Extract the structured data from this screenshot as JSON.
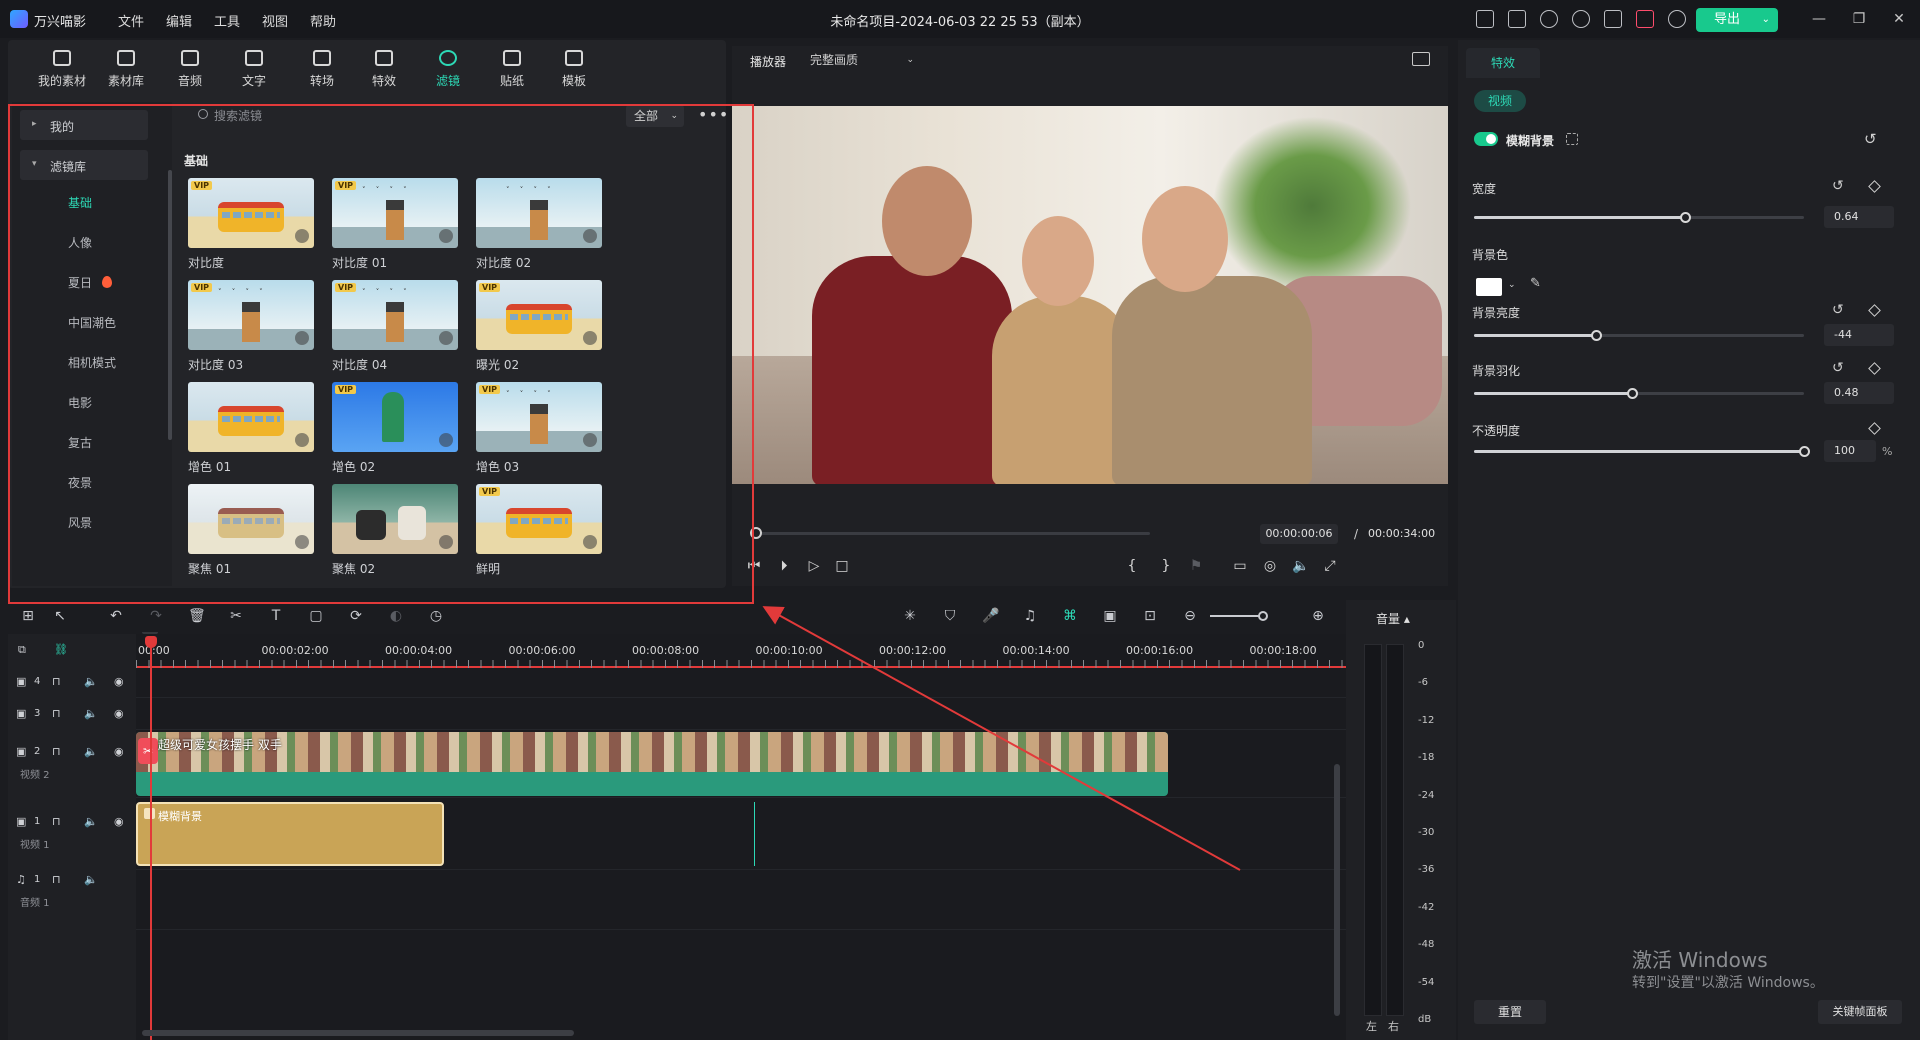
{
  "app": {
    "name": "万兴喵影",
    "project_title": "未命名项目-2024-06-03 22 25 53（副本）",
    "menu": [
      "文件",
      "编辑",
      "工具",
      "视图",
      "帮助"
    ],
    "export_label": "导出",
    "accent_color": "#18c98d"
  },
  "media_tabs": [
    {
      "label": "我的素材",
      "icon": "my-media-icon"
    },
    {
      "label": "素材库",
      "icon": "stock-library-icon"
    },
    {
      "label": "音频",
      "icon": "music-note-icon"
    },
    {
      "label": "文字",
      "icon": "text-icon"
    },
    {
      "label": "转场",
      "icon": "transition-icon"
    },
    {
      "label": "特效",
      "icon": "effects-icon"
    },
    {
      "label": "滤镜",
      "icon": "filters-icon",
      "active": true
    },
    {
      "label": "贴纸",
      "icon": "sticker-icon"
    },
    {
      "label": "模板",
      "icon": "template-icon"
    }
  ],
  "filter_sidebar": {
    "mine": "我的",
    "library": "滤镜库",
    "categories": [
      "基础",
      "人像",
      "夏日",
      "中国潮色",
      "相机模式",
      "电影",
      "复古",
      "夜景",
      "风景"
    ],
    "active": "基础"
  },
  "filter_search": {
    "placeholder": "搜索滤镜",
    "filter_value": "全部",
    "more_icon": "more-dots-icon"
  },
  "filter_section": "基础",
  "filters": [
    {
      "label": "对比度",
      "vip": true,
      "scene": "bus"
    },
    {
      "label": "对比度 01",
      "vip": true,
      "scene": "tower"
    },
    {
      "label": "对比度 02",
      "vip": false,
      "scene": "tower"
    },
    {
      "label": "对比度 03",
      "vip": true,
      "scene": "tower"
    },
    {
      "label": "对比度 04",
      "vip": true,
      "scene": "tower"
    },
    {
      "label": "曝光 02",
      "vip": true,
      "scene": "bus"
    },
    {
      "label": "增色 01",
      "vip": false,
      "scene": "bus"
    },
    {
      "label": "增色 02",
      "vip": true,
      "scene": "blue"
    },
    {
      "label": "增色 03",
      "vip": true,
      "scene": "tower"
    },
    {
      "label": "聚焦 01",
      "vip": false,
      "scene": "bus-gray"
    },
    {
      "label": "聚焦 02",
      "vip": false,
      "scene": "green"
    },
    {
      "label": "鲜明",
      "vip": true,
      "scene": "bus"
    }
  ],
  "vip_badge": "VIP",
  "player": {
    "label": "播放器",
    "quality": "完整画质",
    "time_current": "00:00:00:06",
    "time_separator": "/",
    "time_total": "00:00:34:00",
    "progress": 0.005
  },
  "effects_panel": {
    "tab": "特效",
    "subtab": "视频",
    "blur_title": "模糊背景",
    "blur_enabled": true,
    "props": [
      {
        "label": "宽度",
        "value": "0.64",
        "fraction": 0.64,
        "reset": true
      },
      {
        "label": "背景色",
        "color": "#ffffff"
      },
      {
        "label": "背景亮度",
        "value": "-44",
        "fraction": 0.37,
        "reset": true
      },
      {
        "label": "背景羽化",
        "value": "0.48",
        "fraction": 0.48,
        "reset": true
      },
      {
        "label": "不透明度",
        "value": "100",
        "unit": "%",
        "fraction": 1.0,
        "reset": false
      }
    ],
    "reset_label": "重置",
    "keyframe_label": "关键帧面板"
  },
  "windows_activation": {
    "line1": "激活 Windows",
    "line2": "转到\"设置\"以激活 Windows。"
  },
  "timeline": {
    "ruler": [
      "00:00",
      "00:00:02:00",
      "00:00:04:00",
      "00:00:06:00",
      "00:00:08:00",
      "00:00:10:00",
      "00:00:12:00",
      "00:00:14:00",
      "00:00:16:00",
      "00:00:18:00"
    ],
    "tracks": [
      {
        "num": "4",
        "name": ""
      },
      {
        "num": "3",
        "name": ""
      },
      {
        "num": "2",
        "name": "视频 2"
      },
      {
        "num": "1",
        "name": "视频 1"
      },
      {
        "num": "1",
        "name": "音频 1"
      }
    ],
    "clip_video_title": "超级可爱女孩摆手 双手",
    "clip_blur_label": "模糊背景"
  },
  "meter": {
    "title": "音量",
    "ticks": [
      "0",
      "-6",
      "-12",
      "-18",
      "-24",
      "-30",
      "-36",
      "-42",
      "-48",
      "-54",
      "dB"
    ],
    "left": "左",
    "right": "右"
  }
}
